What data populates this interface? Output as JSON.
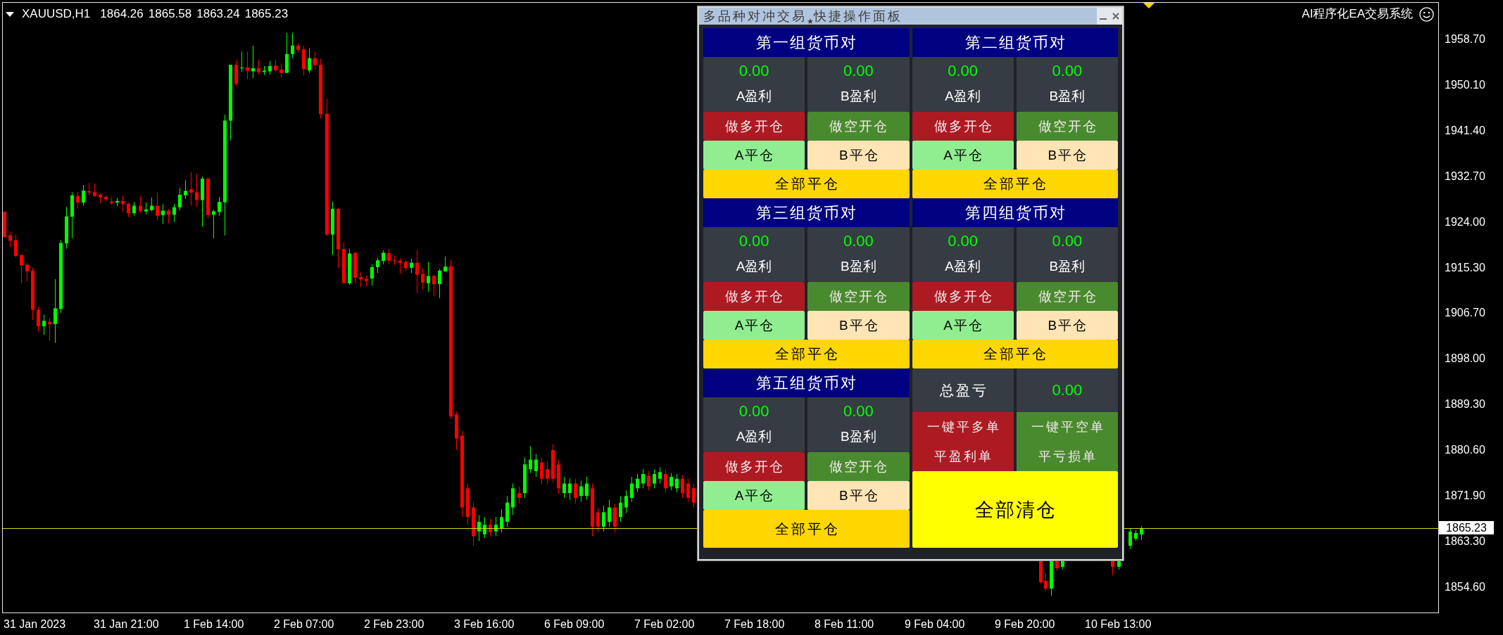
{
  "chart": {
    "symbol": "XAUUSD,H1",
    "quotes": [
      "1864.26",
      "1865.58",
      "1863.24",
      "1865.23"
    ],
    "indicator": "AI程序化EA交易系统"
  },
  "panel": {
    "title": "多品种对冲交易$_{★}$快捷操作面板",
    "groups": [
      {
        "title": "第一组货币对",
        "profits": [
          {
            "value": "0.00",
            "label": "A盈利"
          },
          {
            "value": "0.00",
            "label": "B盈利"
          }
        ],
        "open_buttons": [
          {
            "label": "做多开仓",
            "color": "#ae1a22"
          },
          {
            "label": "做空开仓",
            "color": "#4a8a2e"
          }
        ],
        "close_buttons": [
          {
            "label": "A平仓",
            "color": "#90ee90"
          },
          {
            "label": "B平仓",
            "color": "#ffe4b5"
          }
        ],
        "close_all": "全部平仓"
      },
      {
        "title": "第二组货币对",
        "profits": [
          {
            "value": "0.00",
            "label": "A盈利"
          },
          {
            "value": "0.00",
            "label": "B盈利"
          }
        ],
        "open_buttons": [
          {
            "label": "做多开仓",
            "color": "#ae1a22"
          },
          {
            "label": "做空开仓",
            "color": "#4a8a2e"
          }
        ],
        "close_buttons": [
          {
            "label": "A平仓",
            "color": "#90ee90"
          },
          {
            "label": "B平仓",
            "color": "#ffe4b5"
          }
        ],
        "close_all": "全部平仓"
      },
      {
        "title": "第三组货币对",
        "profits": [
          {
            "value": "0.00",
            "label": "A盈利"
          },
          {
            "value": "0.00",
            "label": "B盈利"
          }
        ],
        "open_buttons": [
          {
            "label": "做多开仓",
            "color": "#ae1a22"
          },
          {
            "label": "做空开仓",
            "color": "#4a8a2e"
          }
        ],
        "close_buttons": [
          {
            "label": "A平仓",
            "color": "#90ee90"
          },
          {
            "label": "B平仓",
            "color": "#ffe4b5"
          }
        ],
        "close_all": "全部平仓"
      },
      {
        "title": "第四组货币对",
        "profits": [
          {
            "value": "0.00",
            "label": "A盈利"
          },
          {
            "value": "0.00",
            "label": "B盈利"
          }
        ],
        "open_buttons": [
          {
            "label": "做多开仓",
            "color": "#ae1a22"
          },
          {
            "label": "做空开仓",
            "color": "#4a8a2e"
          }
        ],
        "close_buttons": [
          {
            "label": "A平仓",
            "color": "#90ee90"
          },
          {
            "label": "B平仓",
            "color": "#ffe4b5"
          }
        ],
        "close_all": "全部平仓"
      },
      {
        "title": "第五组货币对",
        "profits": [
          {
            "value": "0.00",
            "label": "A盈利"
          },
          {
            "value": "0.00",
            "label": "B盈利"
          }
        ],
        "open_buttons": [
          {
            "label": "做多开仓",
            "color": "#ae1a22"
          },
          {
            "label": "做空开仓",
            "color": "#4a8a2e"
          }
        ],
        "close_buttons": [
          {
            "label": "A平仓",
            "color": "#90ee90"
          },
          {
            "label": "B平仓",
            "color": "#ffe4b5"
          }
        ],
        "close_all": "全部平仓"
      }
    ],
    "summary": {
      "label": "总盈亏",
      "value": "0.00"
    },
    "actions": [
      {
        "label": "一键平多单",
        "color": "#ae1a22"
      },
      {
        "label": "一键平空单",
        "color": "#4a8a2e"
      },
      {
        "label": "平盈利单",
        "color": "#ae1a22"
      },
      {
        "label": "平亏损单",
        "color": "#4a8a2e"
      }
    ],
    "clear_all": "全部清仓"
  },
  "price_axis": {
    "labels": [
      "1958.70",
      "1950.10",
      "1941.40",
      "1932.70",
      "1924.00",
      "1915.30",
      "1906.70",
      "1898.00",
      "1889.30",
      "1880.60",
      "1871.90",
      "1863.30",
      "1854.60"
    ],
    "current_price": "1865.23"
  },
  "time_axis": {
    "labels": [
      "31 Jan 2023",
      "31 Jan 21:00",
      "1 Feb 14:00",
      "2 Feb 07:00",
      "2 Feb 23:00",
      "3 Feb 16:00",
      "6 Feb 09:00",
      "7 Feb 02:00",
      "7 Feb 18:00",
      "8 Feb 11:00",
      "9 Feb 04:00",
      "9 Feb 20:00",
      "10 Feb 13:00"
    ]
  }
}
